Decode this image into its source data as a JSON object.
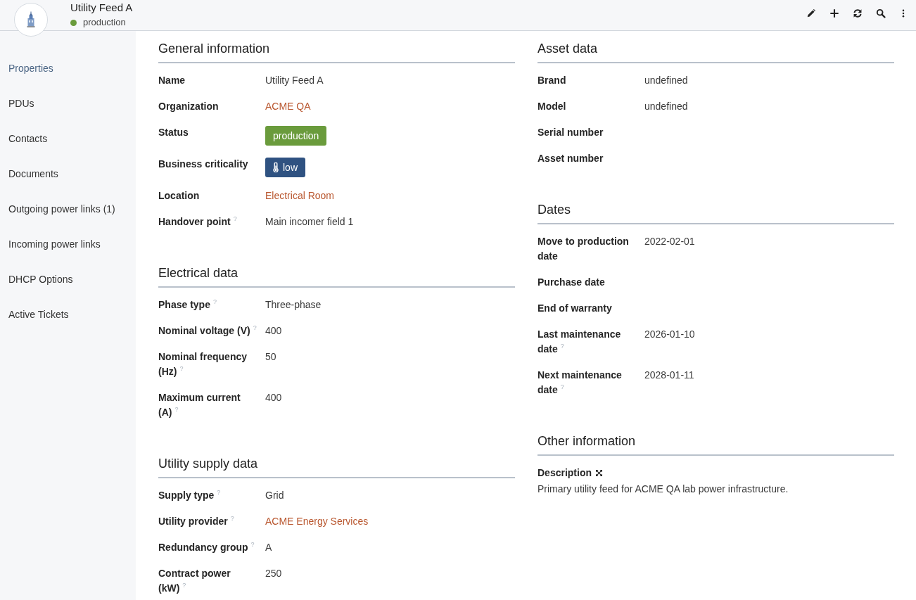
{
  "header": {
    "title": "Utility Feed A",
    "status": {
      "label": "production",
      "color": "#6a9b3c"
    }
  },
  "sidebar": {
    "items": [
      {
        "label": "Properties",
        "selected": true
      },
      {
        "label": "PDUs",
        "selected": false
      },
      {
        "label": "Contacts",
        "selected": false
      },
      {
        "label": "Documents",
        "selected": false
      },
      {
        "label": "Outgoing power links (1)",
        "selected": false
      },
      {
        "label": "Incoming power links",
        "selected": false
      },
      {
        "label": "DHCP Options",
        "selected": false
      },
      {
        "label": "Active Tickets",
        "selected": false
      }
    ]
  },
  "columns": [
    {
      "sections": [
        {
          "title": "General information",
          "fields": [
            {
              "label": "Name",
              "kind": "text",
              "value": "Utility Feed A"
            },
            {
              "label": "Organization",
              "kind": "link",
              "value": "ACME QA"
            },
            {
              "label": "Status",
              "kind": "badge",
              "value": "production",
              "color": "#6a9b3c"
            },
            {
              "label": "Business criticality",
              "kind": "iconbadge",
              "value": "low",
              "color": "#2f5281"
            },
            {
              "label": "Location",
              "kind": "link",
              "value": "Electrical Room"
            },
            {
              "label": "Handover point",
              "hint": "?",
              "kind": "text",
              "value": "Main incomer field 1"
            }
          ]
        },
        {
          "title": "Electrical data",
          "fields": [
            {
              "label": "Phase type",
              "hint": "?",
              "kind": "text",
              "value": "Three-phase"
            },
            {
              "label": "Nominal voltage (V)",
              "hint": "?",
              "kind": "text",
              "value": "400"
            },
            {
              "label": "Nominal frequency (Hz)",
              "hint": "?",
              "kind": "text",
              "value": "50"
            },
            {
              "label": "Maximum current (A)",
              "hint": "?",
              "kind": "text",
              "value": "400"
            }
          ]
        },
        {
          "title": "Utility supply data",
          "fields": [
            {
              "label": "Supply type",
              "hint": "?",
              "kind": "text",
              "value": "Grid"
            },
            {
              "label": "Utility provider",
              "hint": "?",
              "kind": "link",
              "value": "ACME Energy Services"
            },
            {
              "label": "Redundancy group",
              "hint": "?",
              "kind": "text",
              "value": "A"
            },
            {
              "label": "Contract power (kW)",
              "hint": "?",
              "kind": "text",
              "value": "250"
            }
          ]
        }
      ]
    },
    {
      "sections": [
        {
          "title": "Asset data",
          "fields": [
            {
              "label": "Brand",
              "kind": "text",
              "value": "undefined"
            },
            {
              "label": "Model",
              "kind": "text",
              "value": "undefined"
            },
            {
              "label": "Serial number",
              "kind": "text"
            },
            {
              "label": "Asset number",
              "kind": "text"
            }
          ]
        },
        {
          "title": "Dates",
          "fields": [
            {
              "label": "Move to production date",
              "kind": "text",
              "value": "2022-02-01"
            },
            {
              "label": "Purchase date",
              "kind": "text"
            },
            {
              "label": "End of warranty",
              "kind": "text"
            },
            {
              "label": "Last maintenance date",
              "hint": "?",
              "kind": "text",
              "value": "2026-01-10"
            },
            {
              "label": "Next maintenance date",
              "hint": "?",
              "kind": "text",
              "value": "2028-01-11"
            }
          ]
        },
        {
          "title": "Other information",
          "fields": [
            {
              "label": "Description",
              "kind": "description",
              "value": "Primary utility feed for ACME QA lab power infrastructure."
            }
          ]
        }
      ]
    }
  ]
}
